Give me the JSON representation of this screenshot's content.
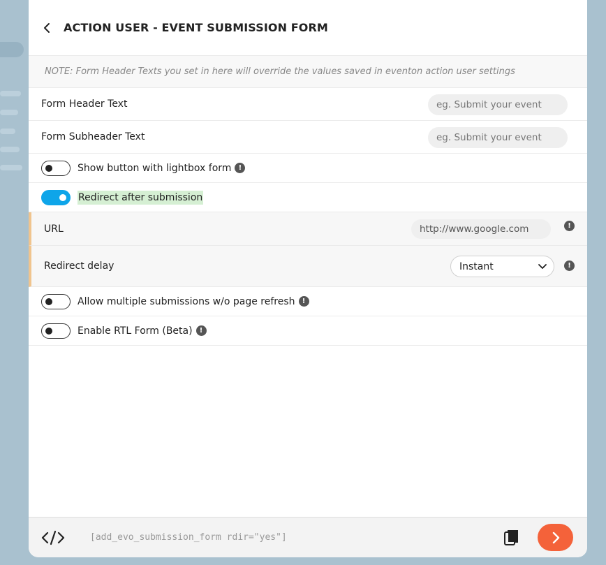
{
  "header": {
    "title": "ACTION USER - EVENT SUBMISSION FORM",
    "back_icon": "chevron-left-icon"
  },
  "note": "NOTE: Form Header Texts you set in here will override the values saved in eventon action user settings",
  "fields": {
    "form_header": {
      "label": "Form Header Text",
      "placeholder": "eg. Submit your event"
    },
    "form_subheader": {
      "label": "Form Subheader Text",
      "placeholder": "eg. Submit your event"
    }
  },
  "toggles": {
    "lightbox": {
      "label": "Show button with lightbox form",
      "on": false
    },
    "redirect": {
      "label": "Redirect after submission",
      "on": true
    },
    "multiple": {
      "label": "Allow multiple submissions w/o page refresh",
      "on": false
    },
    "rtl": {
      "label": "Enable RTL Form (Beta)",
      "on": false
    }
  },
  "redirect_settings": {
    "url": {
      "label": "URL",
      "value": "http://www.google.com"
    },
    "delay": {
      "label": "Redirect delay",
      "selected": "Instant"
    }
  },
  "info_glyph": "!",
  "footer": {
    "shortcode": "[add_evo_submission_form rdir=\"yes\"]"
  },
  "colors": {
    "accent_toggle": "#0ea5e9",
    "go_button": "#f4623a",
    "sub_border": "#f0c48e",
    "highlight": "#d5efd3"
  }
}
